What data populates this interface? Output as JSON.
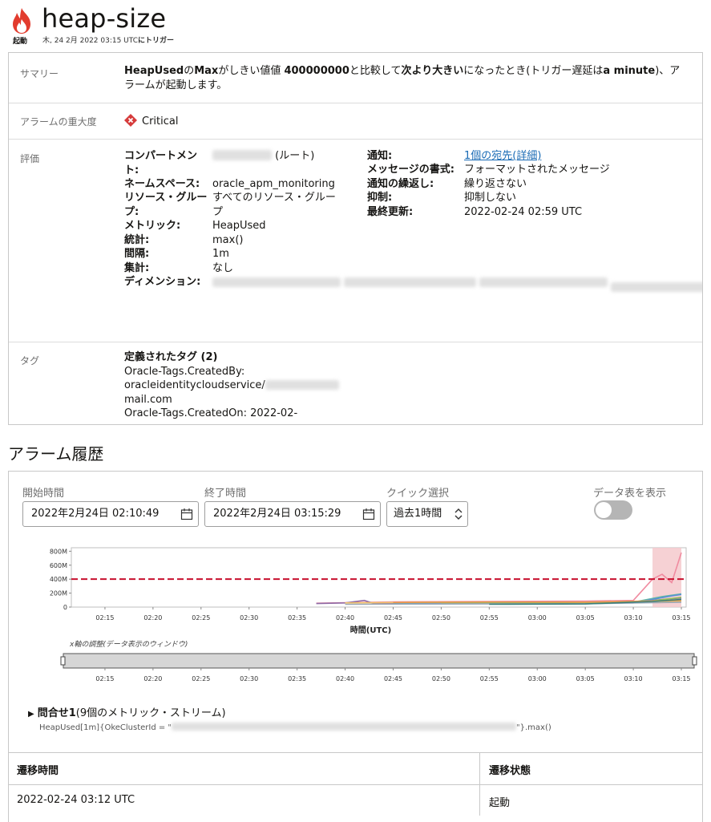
{
  "header": {
    "title": "heap-size",
    "status_label": "起動",
    "trigger_time": "木, 24 2月 2022 03:15 UTC",
    "trigger_suffix": "にトリガー"
  },
  "details": {
    "summary": {
      "label": "サマリー",
      "metric": "HeapUsed",
      "p1": "の",
      "stat": "Max",
      "p2": "がしきい値値 ",
      "threshold": "400000000",
      "p3": "と比較して",
      "operator": "次より大きい",
      "p4": "になったとき(トリガー遅延は",
      "delay": "a minute",
      "p5": ")、アラームが起動します。"
    },
    "severity": {
      "label": "アラームの重大度",
      "value": "Critical",
      "color": "#d63b3b"
    },
    "evaluation": {
      "label": "評価",
      "compartment_key": "コンパートメント:",
      "compartment_value": "(ルート)",
      "namespace_key": "ネームスペース:",
      "namespace_value": "oracle_apm_monitoring",
      "resource_group_key": "リソース・グループ:",
      "resource_group_value": "すべてのリソース・グループ",
      "metric_key": "メトリック:",
      "metric_value": "HeapUsed",
      "statistic_key": "統計:",
      "statistic_value": "max()",
      "interval_key": "間隔:",
      "interval_value": "1m",
      "aggregation_key": "集計:",
      "aggregation_value": "なし",
      "dimension_key": "ディメンション:",
      "notification_key": "通知:",
      "notification_value": "1個の宛先(詳細)",
      "message_format_key": "メッセージの書式:",
      "message_format_value": "フォーマットされたメッセージ",
      "repeat_key": "通知の繰返し:",
      "repeat_value": "繰り返さない",
      "suppress_key": "抑制:",
      "suppress_value": "抑制しない",
      "last_updated_key": "最終更新:",
      "last_updated_value": "2022-02-24 02:59 UTC"
    },
    "tags": {
      "label": "タグ",
      "heading": "定義されたタグ (2)",
      "line1": "Oracle-Tags.CreatedBy:",
      "line2": "oracleidentitycloudservice/",
      "line3": "mail.com",
      "line4": "Oracle-Tags.CreatedOn: 2022-02-"
    }
  },
  "history": {
    "title": "アラーム履歴",
    "start_label": "開始時間",
    "start_value": "2022年2月24日 02:10:49",
    "end_label": "終了時間",
    "end_value": "2022年2月24日 03:15:29",
    "quick_label": "クイック選択",
    "quick_value": "過去1時間",
    "show_table_label": "データ表を表示",
    "xaxis_title": "時間(UTC)",
    "window_label": "x軸の調整(データ表示のウィンドウ)",
    "query_label": "問合せ1",
    "query_sub": "(9個のメトリック・ストリーム)",
    "query_expr_start": "HeapUsed[1m]{OkeClusterId = \"",
    "query_expr_end": "\"}.max()",
    "table": {
      "col1": "遷移時間",
      "col2": "遷移状態",
      "rows": [
        {
          "time": "2022-02-24 03:12 UTC",
          "state": "起動"
        }
      ]
    }
  },
  "chart_data": {
    "type": "line",
    "xlabel": "時間(UTC)",
    "ylabel": "",
    "x_ticks": [
      "02:15",
      "02:20",
      "02:25",
      "02:30",
      "02:35",
      "02:40",
      "02:45",
      "02:50",
      "02:55",
      "03:00",
      "03:05",
      "03:10",
      "03:15"
    ],
    "y_ticks": [
      "0",
      "200M",
      "400M",
      "600M",
      "800M"
    ],
    "ylim": [
      0,
      850000000
    ],
    "threshold": 400000000,
    "threshold_color": "#c8102e",
    "alarm_window": [
      "03:12",
      "03:15"
    ],
    "alarm_window_color": "#f4c9cc",
    "series": [
      {
        "color": "#f08ba0",
        "points": [
          [
            "02:37",
            55000000
          ],
          [
            "02:45",
            75000000
          ],
          [
            "02:55",
            80000000
          ],
          [
            "03:05",
            85000000
          ],
          [
            "03:10",
            95000000
          ],
          [
            "03:12",
            400000000
          ],
          [
            "03:13",
            470000000
          ],
          [
            "03:14",
            350000000
          ],
          [
            "03:15",
            780000000
          ]
        ]
      },
      {
        "color": "#8e6aa6",
        "points": [
          [
            "02:37",
            50000000
          ],
          [
            "02:40",
            60000000
          ],
          [
            "02:42",
            95000000
          ],
          [
            "02:43",
            50000000
          ],
          [
            "03:00",
            60000000
          ],
          [
            "03:10",
            70000000
          ],
          [
            "03:14",
            120000000
          ],
          [
            "03:15",
            130000000
          ]
        ]
      },
      {
        "color": "#f3c46b",
        "points": [
          [
            "02:40",
            60000000
          ],
          [
            "02:50",
            70000000
          ],
          [
            "02:55",
            65000000
          ],
          [
            "03:05",
            60000000
          ],
          [
            "03:15",
            80000000
          ]
        ]
      },
      {
        "color": "#5fb8a6",
        "points": [
          [
            "02:45",
            55000000
          ],
          [
            "02:55",
            60000000
          ],
          [
            "03:05",
            65000000
          ],
          [
            "03:10",
            70000000
          ],
          [
            "03:13",
            150000000
          ],
          [
            "03:15",
            190000000
          ]
        ]
      },
      {
        "color": "#5b8fd6",
        "points": [
          [
            "02:45",
            45000000
          ],
          [
            "03:00",
            50000000
          ],
          [
            "03:10",
            60000000
          ],
          [
            "03:14",
            160000000
          ],
          [
            "03:15",
            180000000
          ]
        ]
      },
      {
        "color": "#8fbf5a",
        "points": [
          [
            "02:50",
            50000000
          ],
          [
            "03:05",
            55000000
          ],
          [
            "03:12",
            90000000
          ],
          [
            "03:15",
            140000000
          ]
        ]
      },
      {
        "color": "#e89a4a",
        "points": [
          [
            "02:45",
            65000000
          ],
          [
            "02:55",
            72000000
          ],
          [
            "03:05",
            70000000
          ],
          [
            "03:15",
            95000000
          ]
        ]
      },
      {
        "color": "#9aa7b5",
        "points": [
          [
            "02:40",
            40000000
          ],
          [
            "02:50",
            45000000
          ],
          [
            "03:05",
            48000000
          ],
          [
            "03:15",
            70000000
          ]
        ]
      },
      {
        "color": "#3a7f7a",
        "points": [
          [
            "02:55",
            40000000
          ],
          [
            "03:05",
            45000000
          ],
          [
            "03:12",
            80000000
          ],
          [
            "03:15",
            110000000
          ]
        ]
      }
    ]
  }
}
